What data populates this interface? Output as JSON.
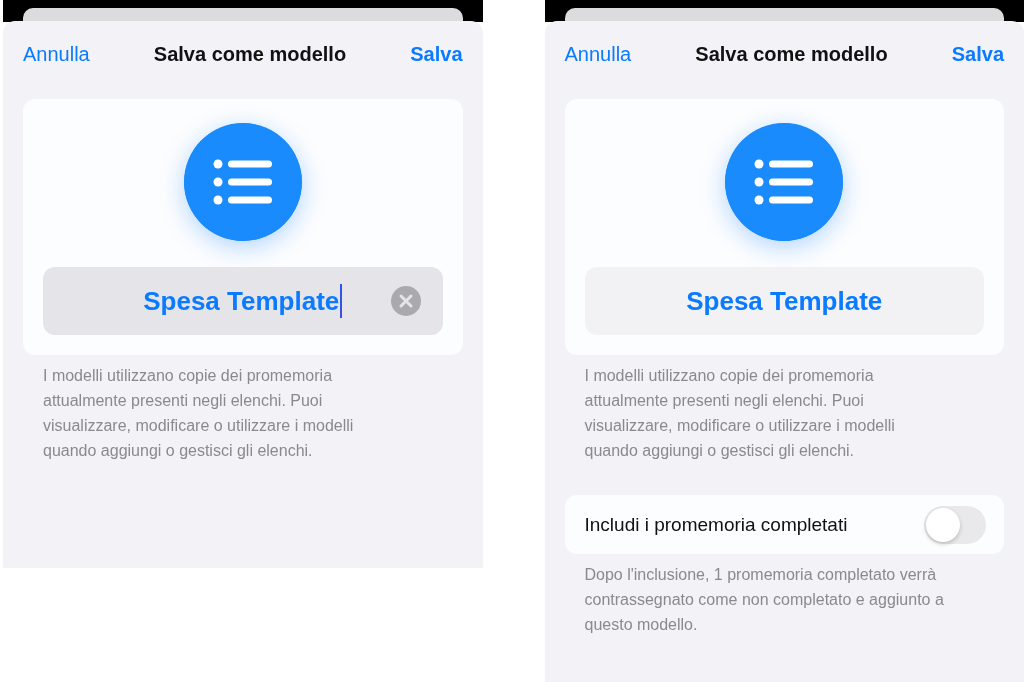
{
  "screens": [
    {
      "header": {
        "cancel": "Annulla",
        "title": "Salva come modello",
        "save": "Salva"
      },
      "name_field": {
        "value": "Spesa Template",
        "focused": true
      },
      "footnote": "I modelli utilizzano copie dei promemoria attualmente presenti negli elenchi. Puoi visualizzare, modificare o utilizzare i modelli quando aggiungi o gestisci gli elenchi."
    },
    {
      "header": {
        "cancel": "Annulla",
        "title": "Salva come modello",
        "save": "Salva"
      },
      "name_field": {
        "value": "Spesa Template",
        "focused": false
      },
      "footnote": "I modelli utilizzano copie dei promemoria attualmente presenti negli elenchi. Puoi visualizzare, modificare o utilizzare i modelli quando aggiungi o gestisci gli elenchi.",
      "option": {
        "label": "Includi i promemoria completati",
        "on": false,
        "note": "Dopo l'inclusione, 1 promemoria completato verrà contrassegnato come non completato e aggiunto a questo modello."
      }
    }
  ]
}
